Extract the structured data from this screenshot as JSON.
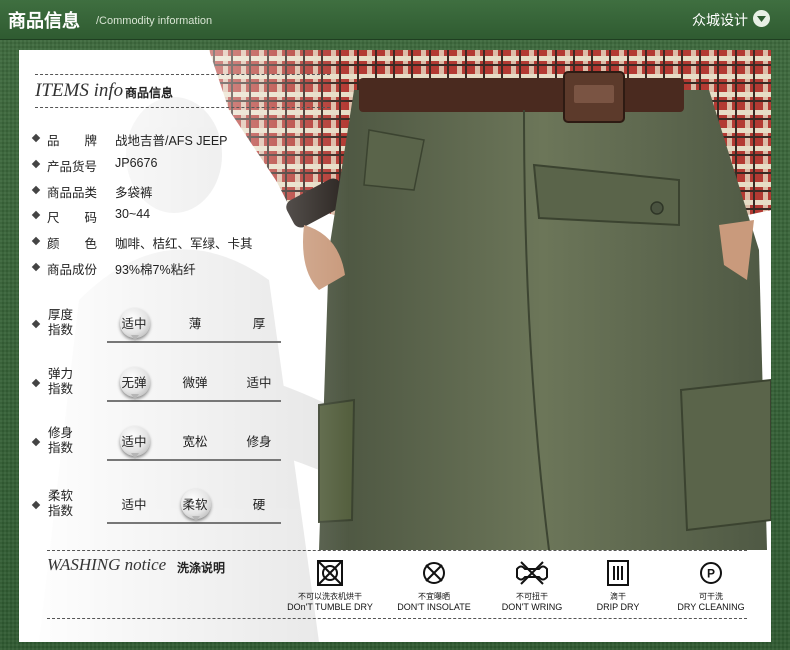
{
  "header": {
    "title": "商品信息",
    "subtitle": "/Commodity information",
    "brand": "众城设计",
    "brand_icon": "chevron-down-circle-icon"
  },
  "items": {
    "title": "ITEMS info",
    "title_cn": "商品信息",
    "specs": [
      {
        "key": "品　　牌",
        "value": "战地吉普/AFS JEEP"
      },
      {
        "key": "产品货号",
        "value": "JP6676"
      },
      {
        "key": "商品品类",
        "value": "多袋裤"
      },
      {
        "key": "尺　　码",
        "value": "30~44"
      },
      {
        "key": "颜　　色",
        "value": "咖啡、桔红、军绿、卡其"
      },
      {
        "key": "商品成份",
        "value": "93%棉7%粘纤"
      }
    ],
    "attributes": [
      {
        "label": "厚度指数",
        "options": [
          "适中",
          "薄",
          "厚"
        ],
        "selected_index": 0
      },
      {
        "label": "弹力指数",
        "options": [
          "无弹",
          "微弹",
          "适中"
        ],
        "selected_index": 0
      },
      {
        "label": "修身指数",
        "options": [
          "适中",
          "宽松",
          "修身"
        ],
        "selected_index": 0
      },
      {
        "label": "柔软指数",
        "options": [
          "适中",
          "柔软",
          "硬"
        ],
        "selected_index": 1
      }
    ]
  },
  "washing": {
    "title": "WASHING notice",
    "title_cn": "洗涤说明",
    "care": [
      {
        "icon": "no-tumble-dry-icon",
        "cn": "不可以洗衣机烘干",
        "en": "DOn'T TUMBLE DRY"
      },
      {
        "icon": "no-insolate-icon",
        "cn": "不宜曝晒",
        "en": "DON'T INSOLATE"
      },
      {
        "icon": "no-wring-icon",
        "cn": "不可扭干",
        "en": "DON'T WRING"
      },
      {
        "icon": "drip-dry-icon",
        "cn": "滴干",
        "en": "DRIP DRY"
      },
      {
        "icon": "dry-cleaning-icon",
        "cn": "可干洗",
        "en": "DRY CLEANING"
      }
    ]
  },
  "colors": {
    "header_green": "#2f5b31",
    "background_green": "#355f35",
    "pants_olive": "#5f6a4f",
    "shirt_red": "#a4302c"
  }
}
